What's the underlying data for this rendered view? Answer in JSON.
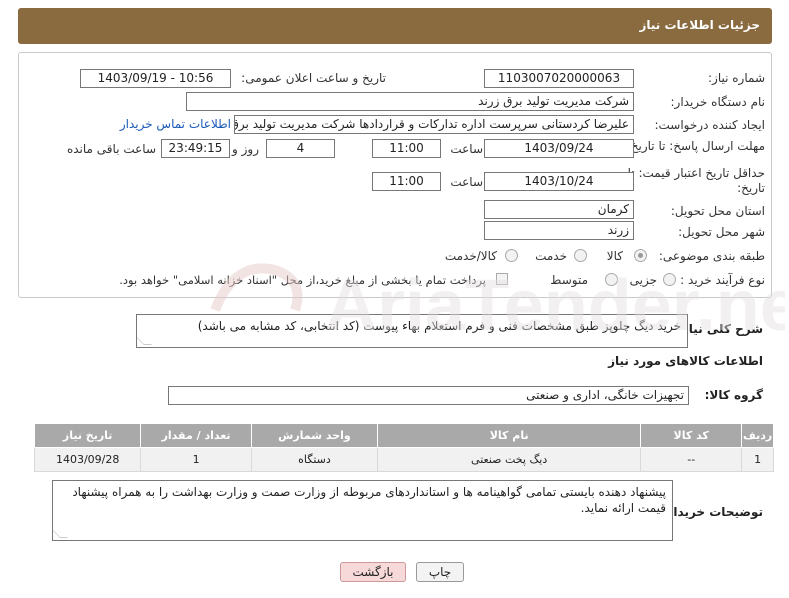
{
  "header": {
    "title": "جزئیات اطلاعات نیاز"
  },
  "form": {
    "need_number_label": "شماره نیاز:",
    "need_number": "1103007020000063",
    "announce_label": "تاریخ و ساعت اعلان عمومی:",
    "announce_value": "1403/09/19 - 10:56",
    "buyer_org_label": "نام دستگاه خریدار:",
    "buyer_org": "شرکت مدیریت تولید برق زرند",
    "requester_label": "ایجاد کننده درخواست:",
    "requester": "علیرضا کردستانی سرپرست اداره تدارکات و قراردادها شرکت مدیریت تولید برق ز",
    "contact_link": "اطلاعات تماس خریدار",
    "reply_deadline_label": "مهلت ارسال پاسخ: تا تاریخ:",
    "reply_date": "1403/09/24",
    "time_label": "ساعت",
    "reply_time": "11:00",
    "days_value": "4",
    "days_label": "روز و",
    "remaining_time": "23:49:15",
    "remaining_label": "ساعت باقی مانده",
    "price_validity_label": "حداقل تاریخ اعتبار قیمت: تا تاریخ:",
    "price_date": "1403/10/24",
    "price_time": "11:00",
    "province_label": "استان محل تحویل:",
    "province": "کرمان",
    "city_label": "شهر محل تحویل:",
    "city": "زرند",
    "category_label": "طبقه بندی موضوعی:",
    "category_options": [
      "کالا",
      "خدمت",
      "کالا/خدمت"
    ],
    "process_label": "نوع فرآیند خرید :",
    "process_options": [
      "جزیی",
      "متوسط"
    ],
    "payment_note": "پرداخت تمام یا بخشی از مبلغ خرید،از محل \"اسناد خزانه اسلامی\" خواهد بود."
  },
  "summary": {
    "label": "شرح کلی نیاز:",
    "text": "خرید دیگ چلوپز طبق مشخصات فنی و فرم استعلام بهاء پیوست (کد انتخابی، کد مشابه می باشد)"
  },
  "goods": {
    "section_title": "اطلاعات کالاهای مورد نیاز",
    "group_label": "گروه کالا:",
    "group_value": "تجهیزات خانگی، اداری و صنعتی",
    "columns": [
      "ردیف",
      "کد کالا",
      "نام کالا",
      "واحد شمارش",
      "تعداد / مقدار",
      "تاریخ نیاز"
    ],
    "rows": [
      [
        "1",
        "--",
        "دیگ پخت صنعتی",
        "دستگاه",
        "1",
        "1403/09/28"
      ]
    ]
  },
  "buyer_notes": {
    "label": "توضیحات خریدار:",
    "text": "پیشنهاد دهنده بایستی تمامی گواهینامه ها و استانداردهای مربوطه از وزارت صمت و وزارت بهداشت را به همراه پیشنهاد قیمت ارائه نماید."
  },
  "buttons": {
    "print": "چاپ",
    "back": "بازگشت"
  },
  "colors": {
    "header": "#8a6a3f",
    "table_header": "#a9a9a9",
    "link": "#1a5ab8",
    "back_button": "#f7d9d9"
  }
}
